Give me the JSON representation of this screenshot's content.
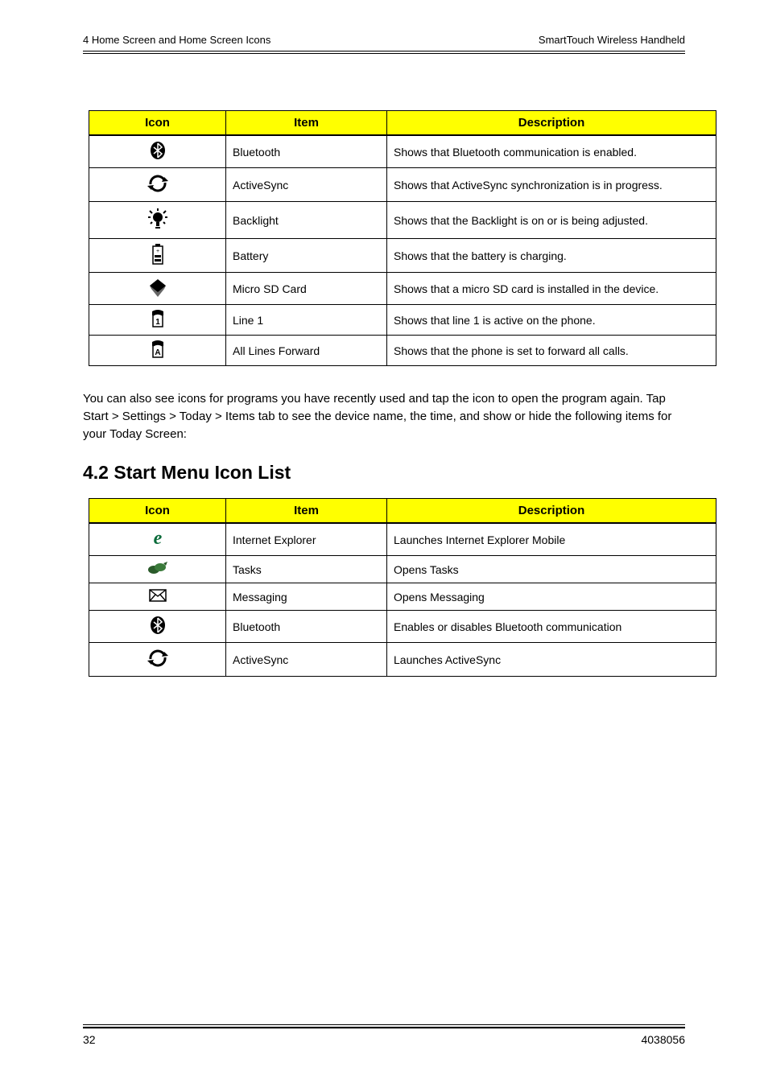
{
  "header": {
    "left": "4 Home Screen and Home Screen Icons",
    "right": "SmartTouch Wireless Handheld"
  },
  "tables": {
    "table1": {
      "headers": [
        "Icon",
        "Item",
        "Description"
      ],
      "rows": [
        {
          "icon": "bluetooth",
          "item": "Bluetooth",
          "desc": "Shows that Bluetooth communication is enabled."
        },
        {
          "icon": "sync",
          "item": "ActiveSync",
          "desc": "Shows that ActiveSync synchronization is in progress."
        },
        {
          "icon": "backlight",
          "item": "Backlight",
          "desc": "Shows that the Backlight is on or is being adjusted."
        },
        {
          "icon": "battery",
          "item": "Battery",
          "desc": "Shows that the battery is charging."
        },
        {
          "icon": "card",
          "item": "Micro SD Card",
          "desc": "Shows that a micro SD card is installed in the device."
        },
        {
          "icon": "line1",
          "item": "Line 1",
          "desc": "Shows that line 1 is active on the phone."
        },
        {
          "icon": "lineall",
          "item": "All Lines Forward",
          "desc": "Shows that the phone is set to forward all calls."
        }
      ]
    },
    "table2": {
      "headers": [
        "Icon",
        "Item",
        "Description"
      ],
      "rows": [
        {
          "icon": "ie",
          "item": "Internet Explorer",
          "desc": "Launches Internet Explorer Mobile"
        },
        {
          "icon": "tasks",
          "item": "Tasks",
          "desc": "Opens Tasks"
        },
        {
          "icon": "messaging",
          "item": "Messaging",
          "desc": "Opens Messaging"
        },
        {
          "icon": "bluetooth",
          "item": "Bluetooth",
          "desc": "Enables or disables Bluetooth communication"
        },
        {
          "icon": "sync",
          "item": "ActiveSync",
          "desc": "Launches ActiveSync"
        }
      ]
    }
  },
  "betweenText": "You can also see icons for programs you have recently used and tap the icon to open the program again. Tap Start > Settings > Today > Items tab to see the device name, the time, and show or hide the following items for your Today Screen:",
  "sect": "4.2 Start Menu Icon List",
  "footer": {
    "left": "32",
    "right": "4038056"
  }
}
